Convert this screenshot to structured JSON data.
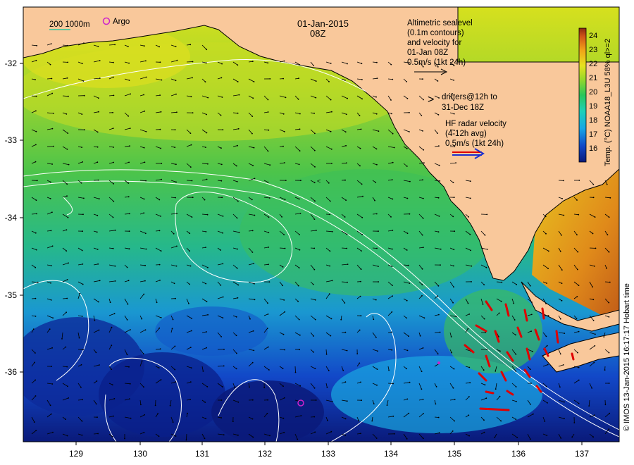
{
  "header": {
    "date": "01-Jan-2015",
    "time": "08Z",
    "scale_bar_label": "200  1000m",
    "argo_label": "Argo"
  },
  "notes": {
    "altimetry_lines": [
      "Altimetric sealevel",
      "(0.1m contours)",
      "and velocity for",
      "01-Jan 08Z",
      "0.5m/s (1kt 24h)"
    ],
    "drifters_lines": [
      "drifters@12h to",
      "31-Dec 18Z"
    ],
    "drifters_symbol": ">",
    "hf_radar_lines": [
      "HF radar velocity",
      "(4-12h avg)",
      "0.5m/s (1kt 24h)"
    ]
  },
  "axes": {
    "x_ticks": [
      "129",
      "130",
      "131",
      "132",
      "133",
      "134",
      "135",
      "136",
      "137"
    ],
    "y_ticks": [
      "-32",
      "-33",
      "-34",
      "-35",
      "-36"
    ]
  },
  "colorbar": {
    "title": "Temp. (°C) NOAA18_L3U 58% ql>=2",
    "ticks": [
      "16",
      "17",
      "18",
      "19",
      "20",
      "21",
      "22",
      "23",
      "24"
    ],
    "colors": [
      "#0a1a7a",
      "#1248c8",
      "#17a6e6",
      "#1fd0b8",
      "#2bc65a",
      "#98d82a",
      "#e6e21e",
      "#f0a018",
      "#d05418",
      "#8a2a10"
    ]
  },
  "credit": "© IMOS 13-Jan-2015 16:17:17 Hobart time",
  "colors": {
    "land": "#f9c89b",
    "current_vectors": "#000000",
    "hf_radar_vectors": "#e00000",
    "argo_marker": "#cc22cc",
    "contours": "#ffffff"
  }
}
